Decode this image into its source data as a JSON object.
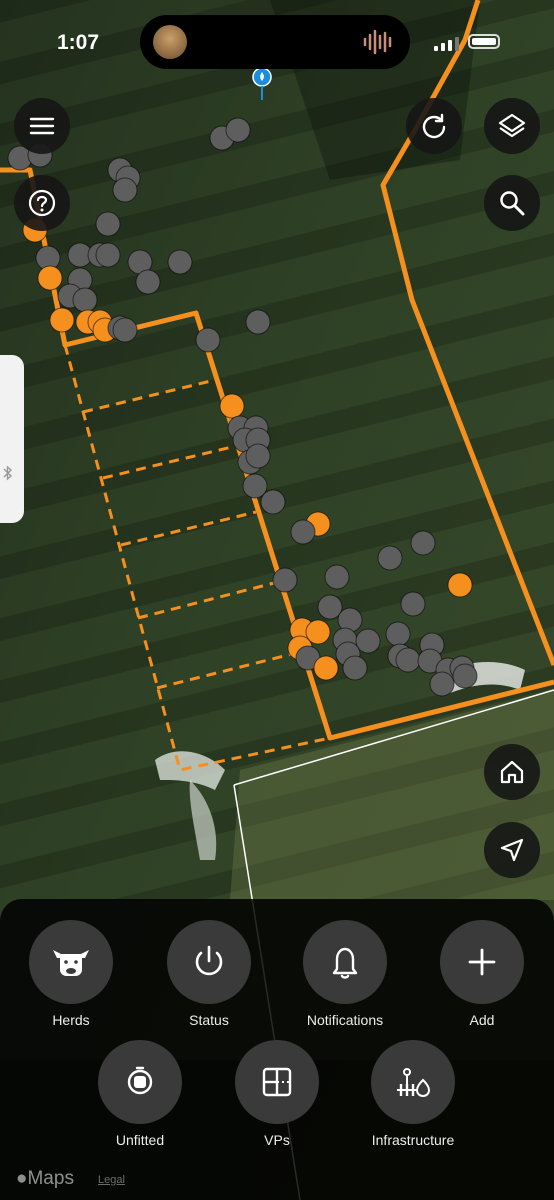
{
  "status_bar": {
    "time": "1:07",
    "battery_level": 0.85,
    "signal_bars": 3
  },
  "map": {
    "attribution": "Maps",
    "legal_label": "Legal",
    "colors": {
      "fence": "#f5901f",
      "animal_alert": "#f5901f",
      "animal_normal": "#5e5e5e",
      "boundary_secondary": "#ffffff"
    }
  },
  "map_controls": {
    "menu": "hamburger-icon",
    "help": "question-icon",
    "refresh": "refresh-icon",
    "layers": "layers-icon",
    "search": "search-icon",
    "home": "home-icon",
    "locate": "navigation-arrow-icon"
  },
  "actions": [
    {
      "label": "Herds",
      "icon": "cow-icon"
    },
    {
      "label": "Status",
      "icon": "power-icon"
    },
    {
      "label": "Notifications",
      "icon": "bell-icon"
    },
    {
      "label": "Add",
      "icon": "plus-icon"
    },
    {
      "label": "Unfitted",
      "icon": "collar-device-icon"
    },
    {
      "label": "VPs",
      "icon": "virtual-paddock-icon"
    },
    {
      "label": "Infrastructure",
      "icon": "infrastructure-icon"
    }
  ]
}
